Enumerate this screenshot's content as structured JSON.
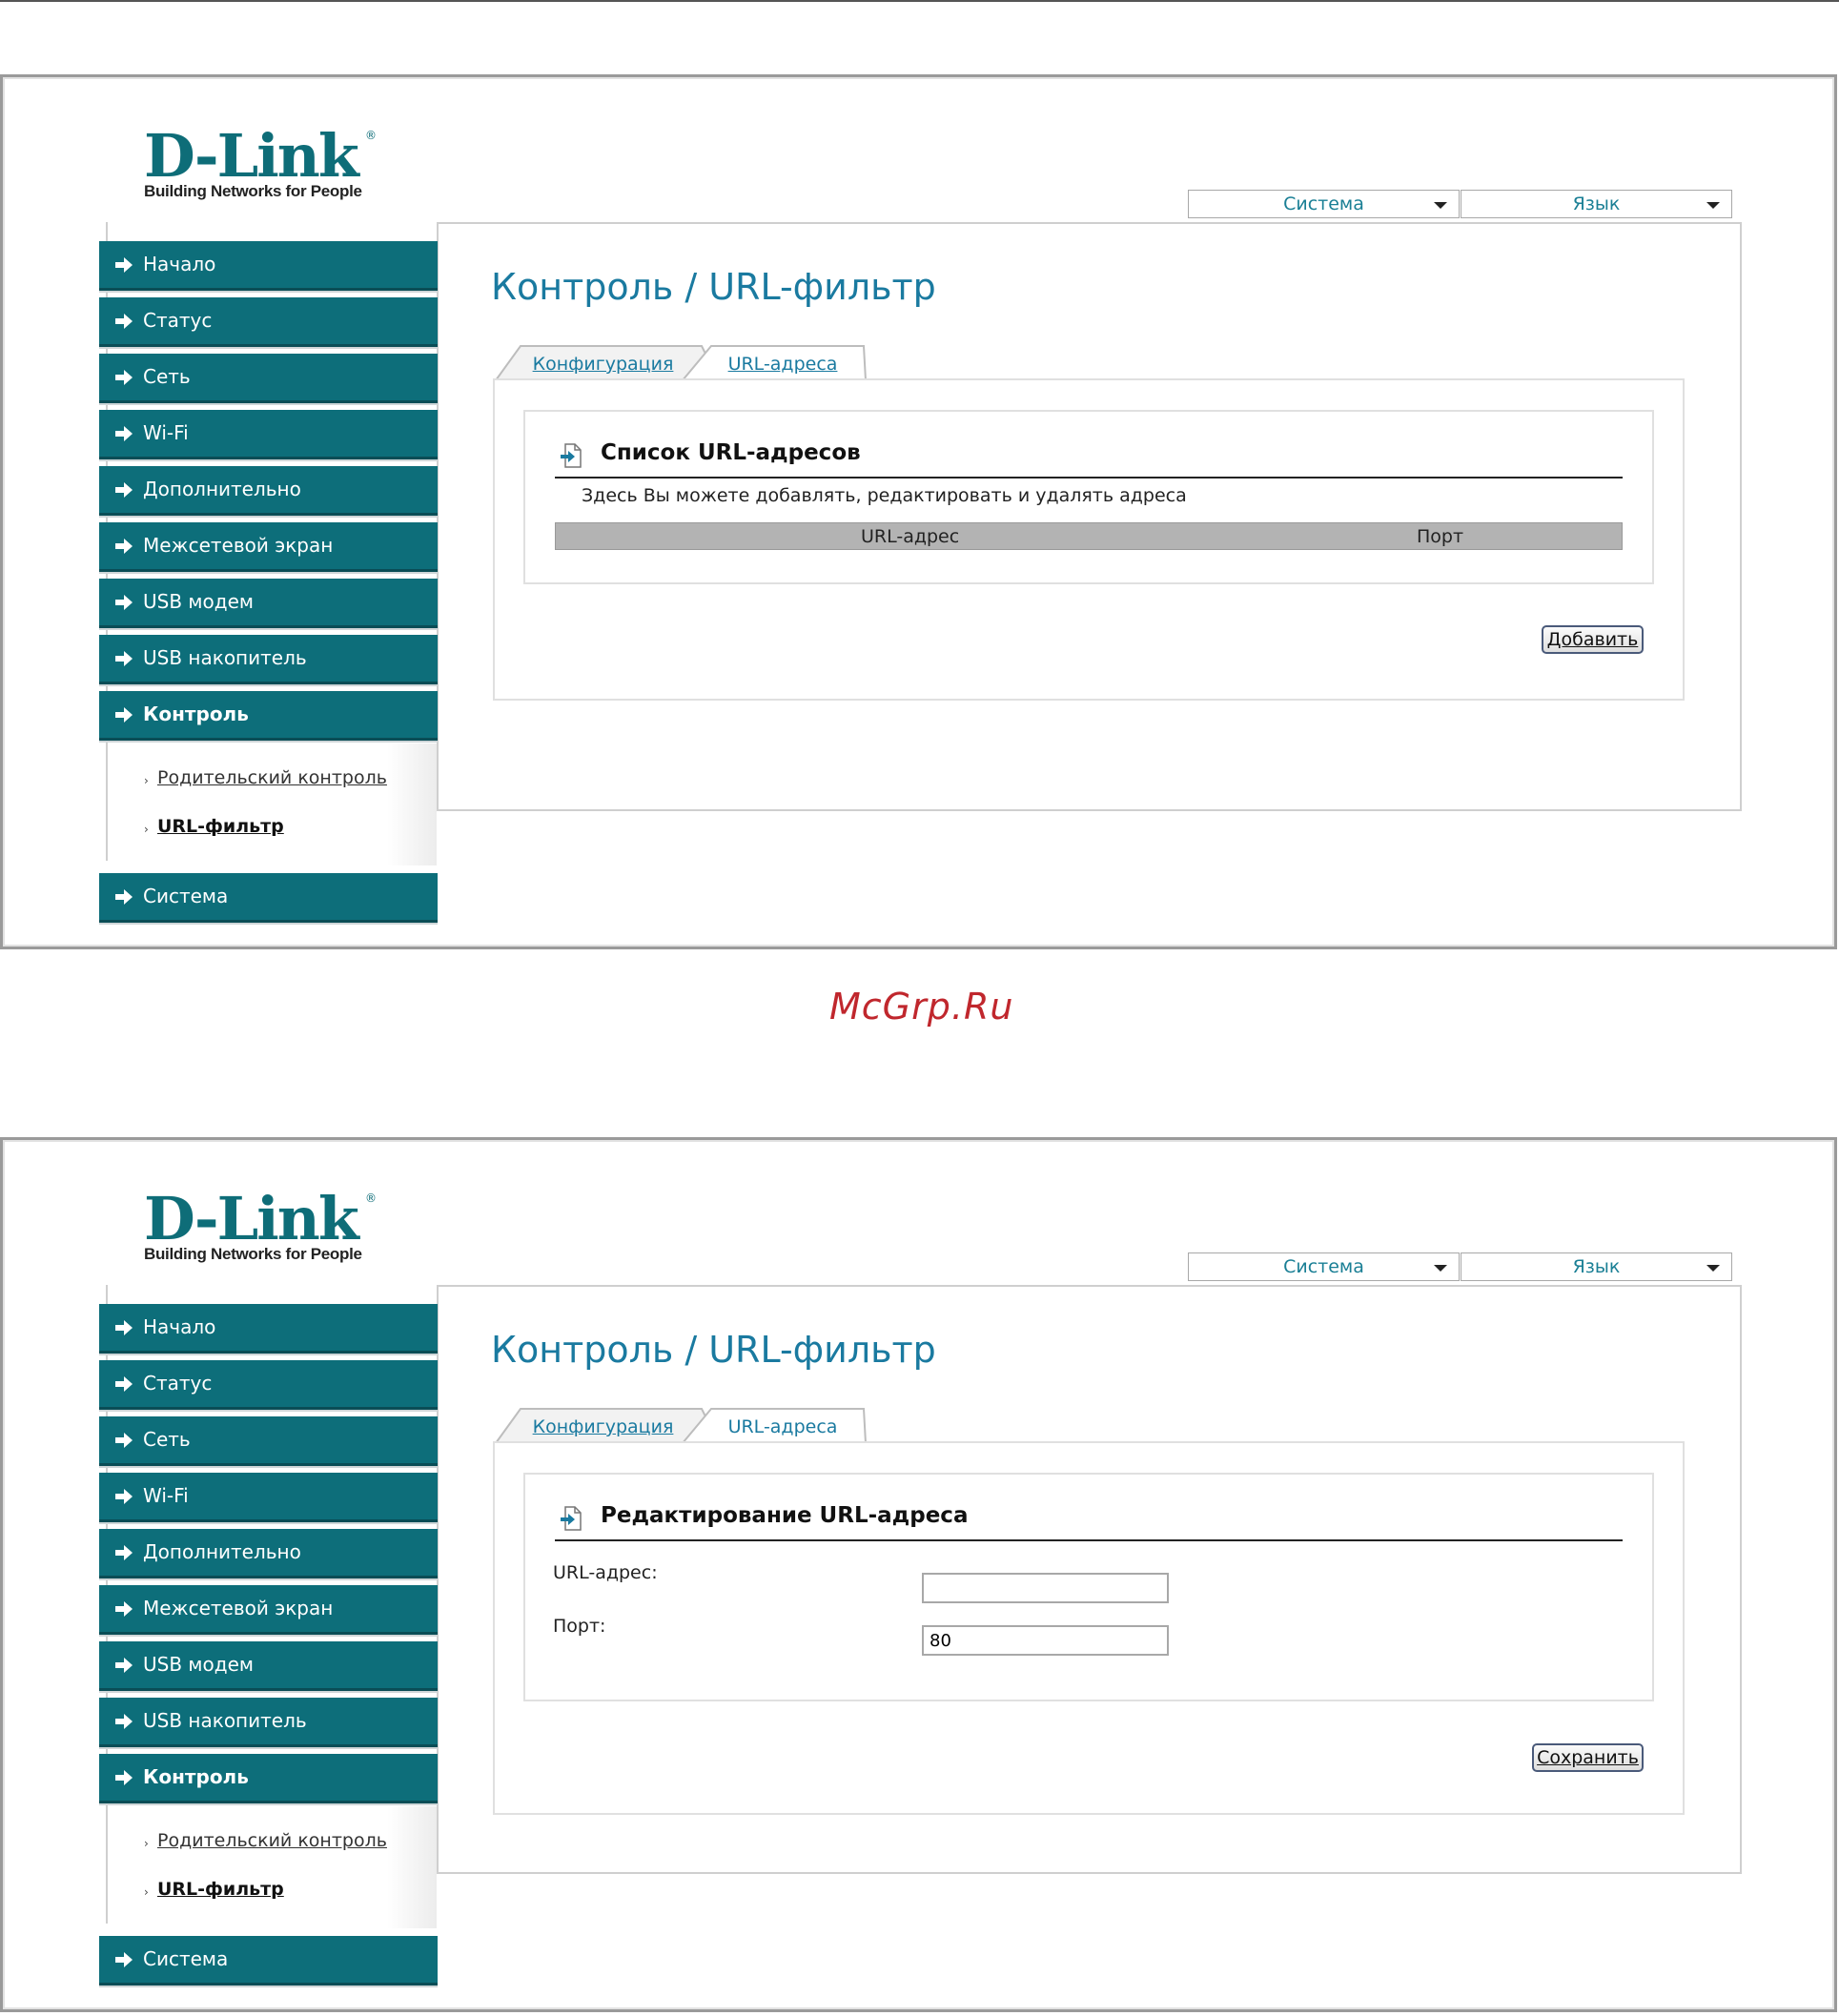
{
  "watermark": "McGrp.Ru",
  "logo": {
    "brand": "D-Link",
    "reg": "®",
    "tagline": "Building Networks for People"
  },
  "top_menus": {
    "system": "Система",
    "language": "Язык"
  },
  "sidebar": {
    "items": [
      "Начало",
      "Статус",
      "Сеть",
      "Wi-Fi",
      "Дополнительно",
      "Межсетевой экран",
      "USB модем",
      "USB накопитель",
      "Контроль",
      "Система"
    ],
    "submenu": [
      "Родительский контроль",
      "URL-фильтр"
    ]
  },
  "page_title": "Контроль / URL-фильтр",
  "tabs": {
    "config": "Конфигурация",
    "urls": "URL-адреса"
  },
  "screen1": {
    "section_title": "Список URL-адресов",
    "description": "Здесь Вы можете добавлять, редактировать и удалять адреса",
    "columns": [
      "URL-адрес",
      "Порт"
    ],
    "add_button": "Добавить"
  },
  "screen2": {
    "section_title": "Редактирование URL-адреса",
    "url_label": "URL-адрес:",
    "url_value": "",
    "port_label": "Порт:",
    "port_value": "80",
    "save_button": "Сохранить"
  }
}
